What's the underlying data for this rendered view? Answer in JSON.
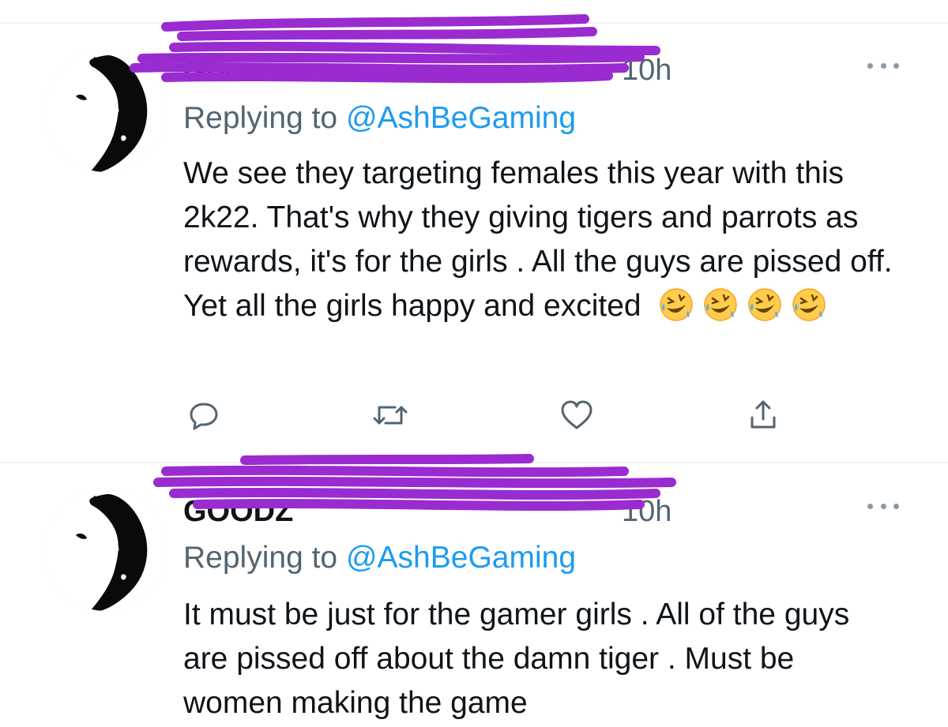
{
  "tweets": [
    {
      "name": "Goo",
      "time": "10h",
      "replying_prefix": "Replying to ",
      "replying_handle": "@AshBeGaming",
      "body": "We see they targeting females this year with this 2k22. That's why they giving tigers and parrots as rewards, it's for the girls . All the guys are pissed off. Yet all the girls happy and excited",
      "emoji": [
        "rolling-on-floor-laughing",
        "rolling-on-floor-laughing",
        "rolling-on-floor-laughing",
        "rolling-on-floor-laughing"
      ],
      "actions": [
        "reply-icon",
        "retweet-icon",
        "like-icon",
        "share-icon"
      ]
    },
    {
      "name": "GOODZ",
      "time": "10h",
      "replying_prefix": "Replying to ",
      "replying_handle": "@AshBeGaming",
      "body": "It must be just for the gamer girls . All of the guys are pissed off about the damn tiger . Must be women making the game"
    }
  ],
  "colors": {
    "text": "#0f1419",
    "secondary": "#536471",
    "link": "#1d9bf0",
    "redaction": "#9a2bd0",
    "divider": "#eff3f4"
  }
}
